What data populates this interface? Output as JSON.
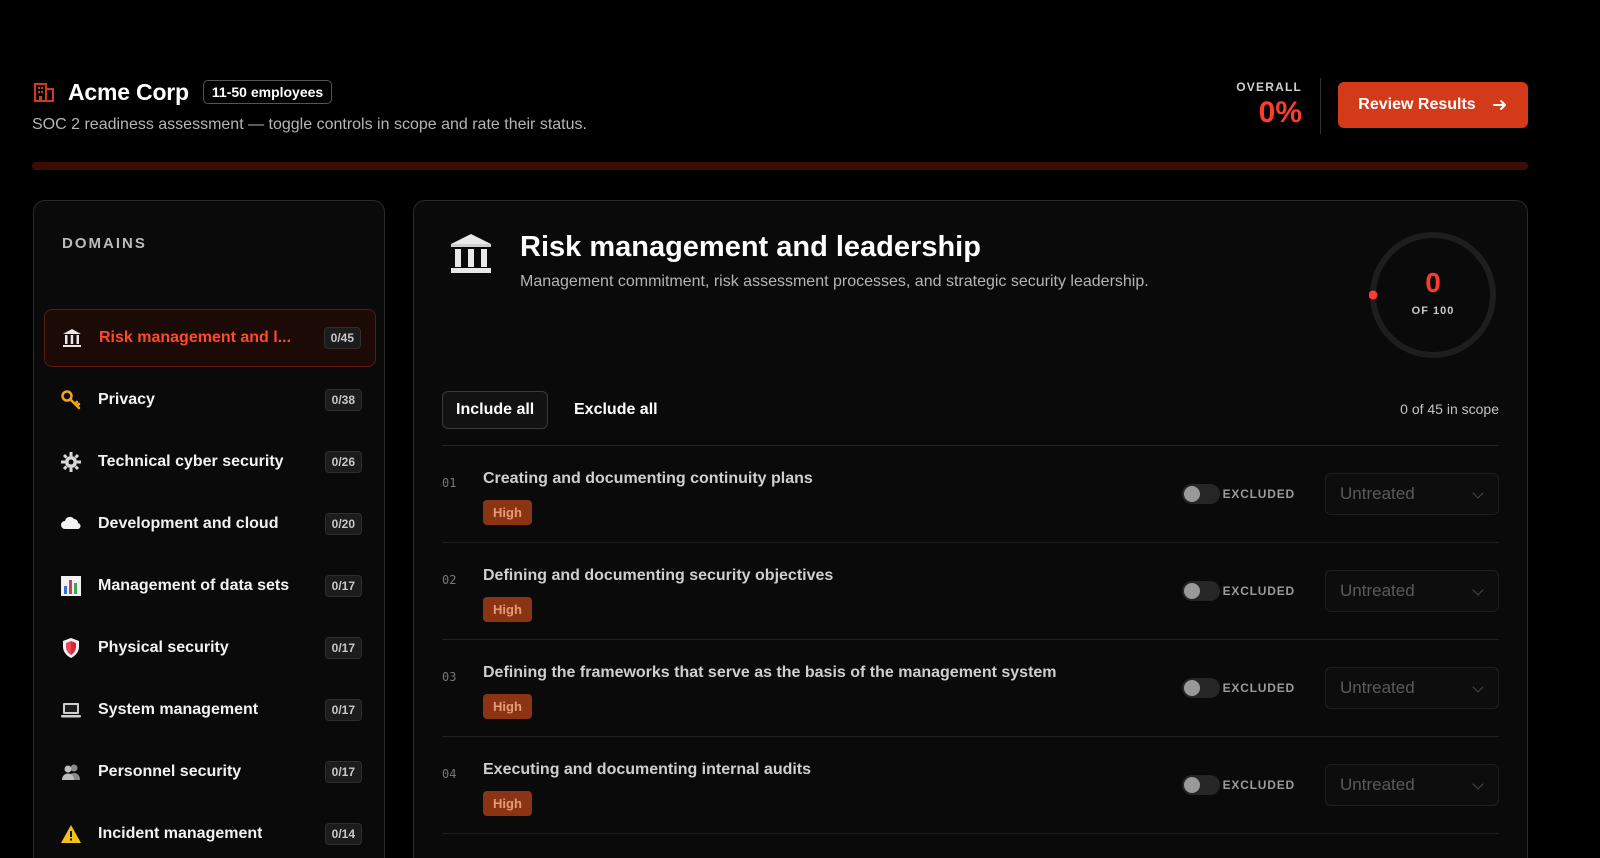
{
  "company": {
    "name": "Acme Corp",
    "size_badge": "11-50 employees",
    "subtitle": "SOC 2 readiness assessment — toggle controls in scope and rate their status."
  },
  "overall": {
    "label": "OVERALL",
    "value": "0%",
    "progress_fraction": 0
  },
  "review_button": {
    "label": "Review Results"
  },
  "sidebar": {
    "title": "DOMAINS",
    "items": [
      {
        "icon": "bank-icon",
        "label": "Risk management and l...",
        "count": "0/45",
        "active": true
      },
      {
        "icon": "key-icon",
        "label": "Privacy",
        "count": "0/38"
      },
      {
        "icon": "gear-icon",
        "label": "Technical cyber security",
        "count": "0/26"
      },
      {
        "icon": "cloud-icon",
        "label": "Development and cloud",
        "count": "0/20"
      },
      {
        "icon": "bar-chart-icon",
        "label": "Management of data sets",
        "count": "0/17"
      },
      {
        "icon": "shield-icon",
        "label": "Physical security",
        "count": "0/17"
      },
      {
        "icon": "laptop-icon",
        "label": "System management",
        "count": "0/17"
      },
      {
        "icon": "people-icon",
        "label": "Personnel security",
        "count": "0/17"
      },
      {
        "icon": "warning-icon",
        "label": "Incident management",
        "count": "0/14"
      }
    ]
  },
  "main": {
    "icon": "bank-icon",
    "title": "Risk management and leadership",
    "description": "Management commitment, risk assessment processes, and strategic security leadership.",
    "score": {
      "value": "0",
      "sub": "OF 100"
    },
    "include_all": "Include all",
    "exclude_all": "Exclude all",
    "scope_count": "0 of 45 in scope",
    "controls": [
      {
        "num": "01",
        "title": "Creating and documenting continuity plans",
        "priority": "High",
        "toggle_label": "EXCLUDED",
        "status": "Untreated"
      },
      {
        "num": "02",
        "title": "Defining and documenting security objectives",
        "priority": "High",
        "toggle_label": "EXCLUDED",
        "status": "Untreated"
      },
      {
        "num": "03",
        "title": "Defining the frameworks that serve as the basis of the management system",
        "priority": "High",
        "toggle_label": "EXCLUDED",
        "status": "Untreated"
      },
      {
        "num": "04",
        "title": "Executing and documenting internal audits",
        "priority": "High",
        "toggle_label": "EXCLUDED",
        "status": "Untreated"
      }
    ]
  },
  "colors": {
    "accent": "#d33a1a",
    "score": "#ff3b30",
    "priority_bg": "#8a3414"
  }
}
